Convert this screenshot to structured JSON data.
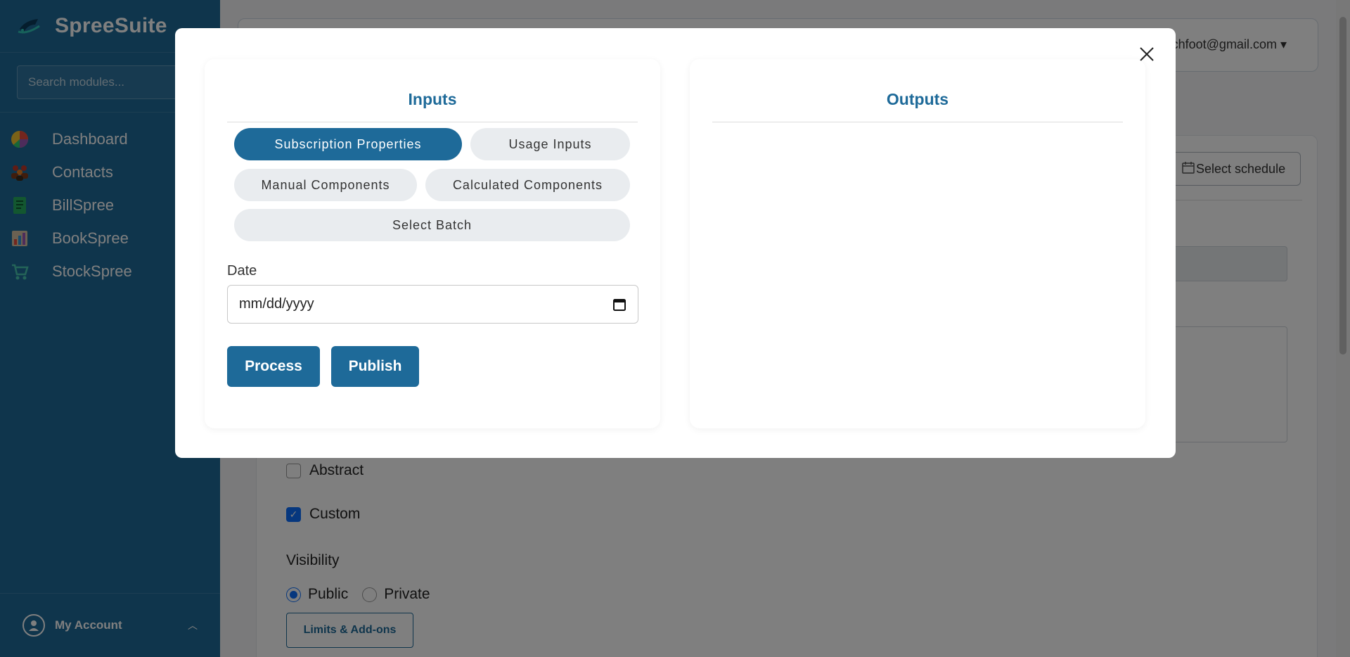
{
  "sidebar": {
    "brand": "SpreeSuite",
    "search_placeholder": "Search modules...",
    "items": [
      {
        "label": "Dashboard",
        "icon": "pie-chart-icon"
      },
      {
        "label": "Contacts",
        "icon": "people-icon"
      },
      {
        "label": "BillSpree",
        "icon": "invoice-icon"
      },
      {
        "label": "BookSpree",
        "icon": "book-chart-icon"
      },
      {
        "label": "StockSpree",
        "icon": "cart-icon"
      }
    ],
    "account_label": "My Account"
  },
  "header": {
    "user_email": "chfoot@gmail.com ▾"
  },
  "background_form": {
    "select_schedule_label": "Select schedule",
    "abstract_label": "Abstract",
    "abstract_checked": false,
    "custom_label": "Custom",
    "custom_checked": true,
    "visibility_label": "Visibility",
    "visibility_options": [
      "Public",
      "Private"
    ],
    "visibility_selected": "Public",
    "limits_button": "Limits & Add-ons"
  },
  "modal": {
    "inputs_title": "Inputs",
    "outputs_title": "Outputs",
    "tabs": [
      {
        "label": "Subscription Properties",
        "active": true
      },
      {
        "label": "Usage Inputs",
        "active": false
      },
      {
        "label": "Manual Components",
        "active": false
      },
      {
        "label": "Calculated Components",
        "active": false
      },
      {
        "label": "Select Batch",
        "active": false
      }
    ],
    "date_label": "Date",
    "date_placeholder": "mm/dd/yyyy",
    "process_button": "Process",
    "publish_button": "Publish"
  },
  "colors": {
    "primary": "#1e6a99",
    "pill_inactive": "#e9ecef",
    "checkbox_accent": "#0d6efd"
  }
}
